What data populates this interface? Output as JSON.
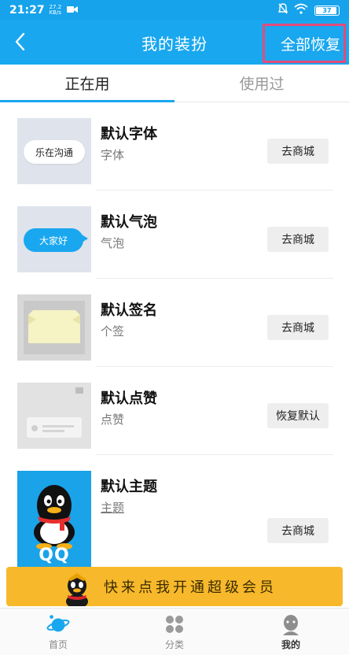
{
  "statusbar": {
    "time": "21:27",
    "netspeed": "27.2 KB/s",
    "battery": "37"
  },
  "navbar": {
    "title": "我的装扮",
    "restore_all": "全部恢复"
  },
  "tabs": [
    {
      "label": "正在用",
      "active": true
    },
    {
      "label": "使用过",
      "active": false
    }
  ],
  "items": [
    {
      "name": "默认字体",
      "sub": "字体",
      "action": "去商城",
      "preview": "乐在沟通"
    },
    {
      "name": "默认气泡",
      "sub": "气泡",
      "action": "去商城",
      "preview": "大家好"
    },
    {
      "name": "默认签名",
      "sub": "个签",
      "action": "去商城"
    },
    {
      "name": "默认点赞",
      "sub": "点赞",
      "action": "恢复默认"
    },
    {
      "name": "默认主题",
      "sub": "主题",
      "action": "去商城",
      "preview": "QQ"
    }
  ],
  "banner": {
    "text": "快来点我开通超级会员"
  },
  "bottomnav": [
    {
      "label": "首页",
      "icon": "planet-icon",
      "active": false
    },
    {
      "label": "分类",
      "icon": "category-icon",
      "active": false
    },
    {
      "label": "我的",
      "icon": "profile-icon",
      "active": true
    }
  ],
  "colors": {
    "primary": "#19a7ef",
    "highlight_border": "#e44b7a",
    "banner": "#f7b92b"
  }
}
